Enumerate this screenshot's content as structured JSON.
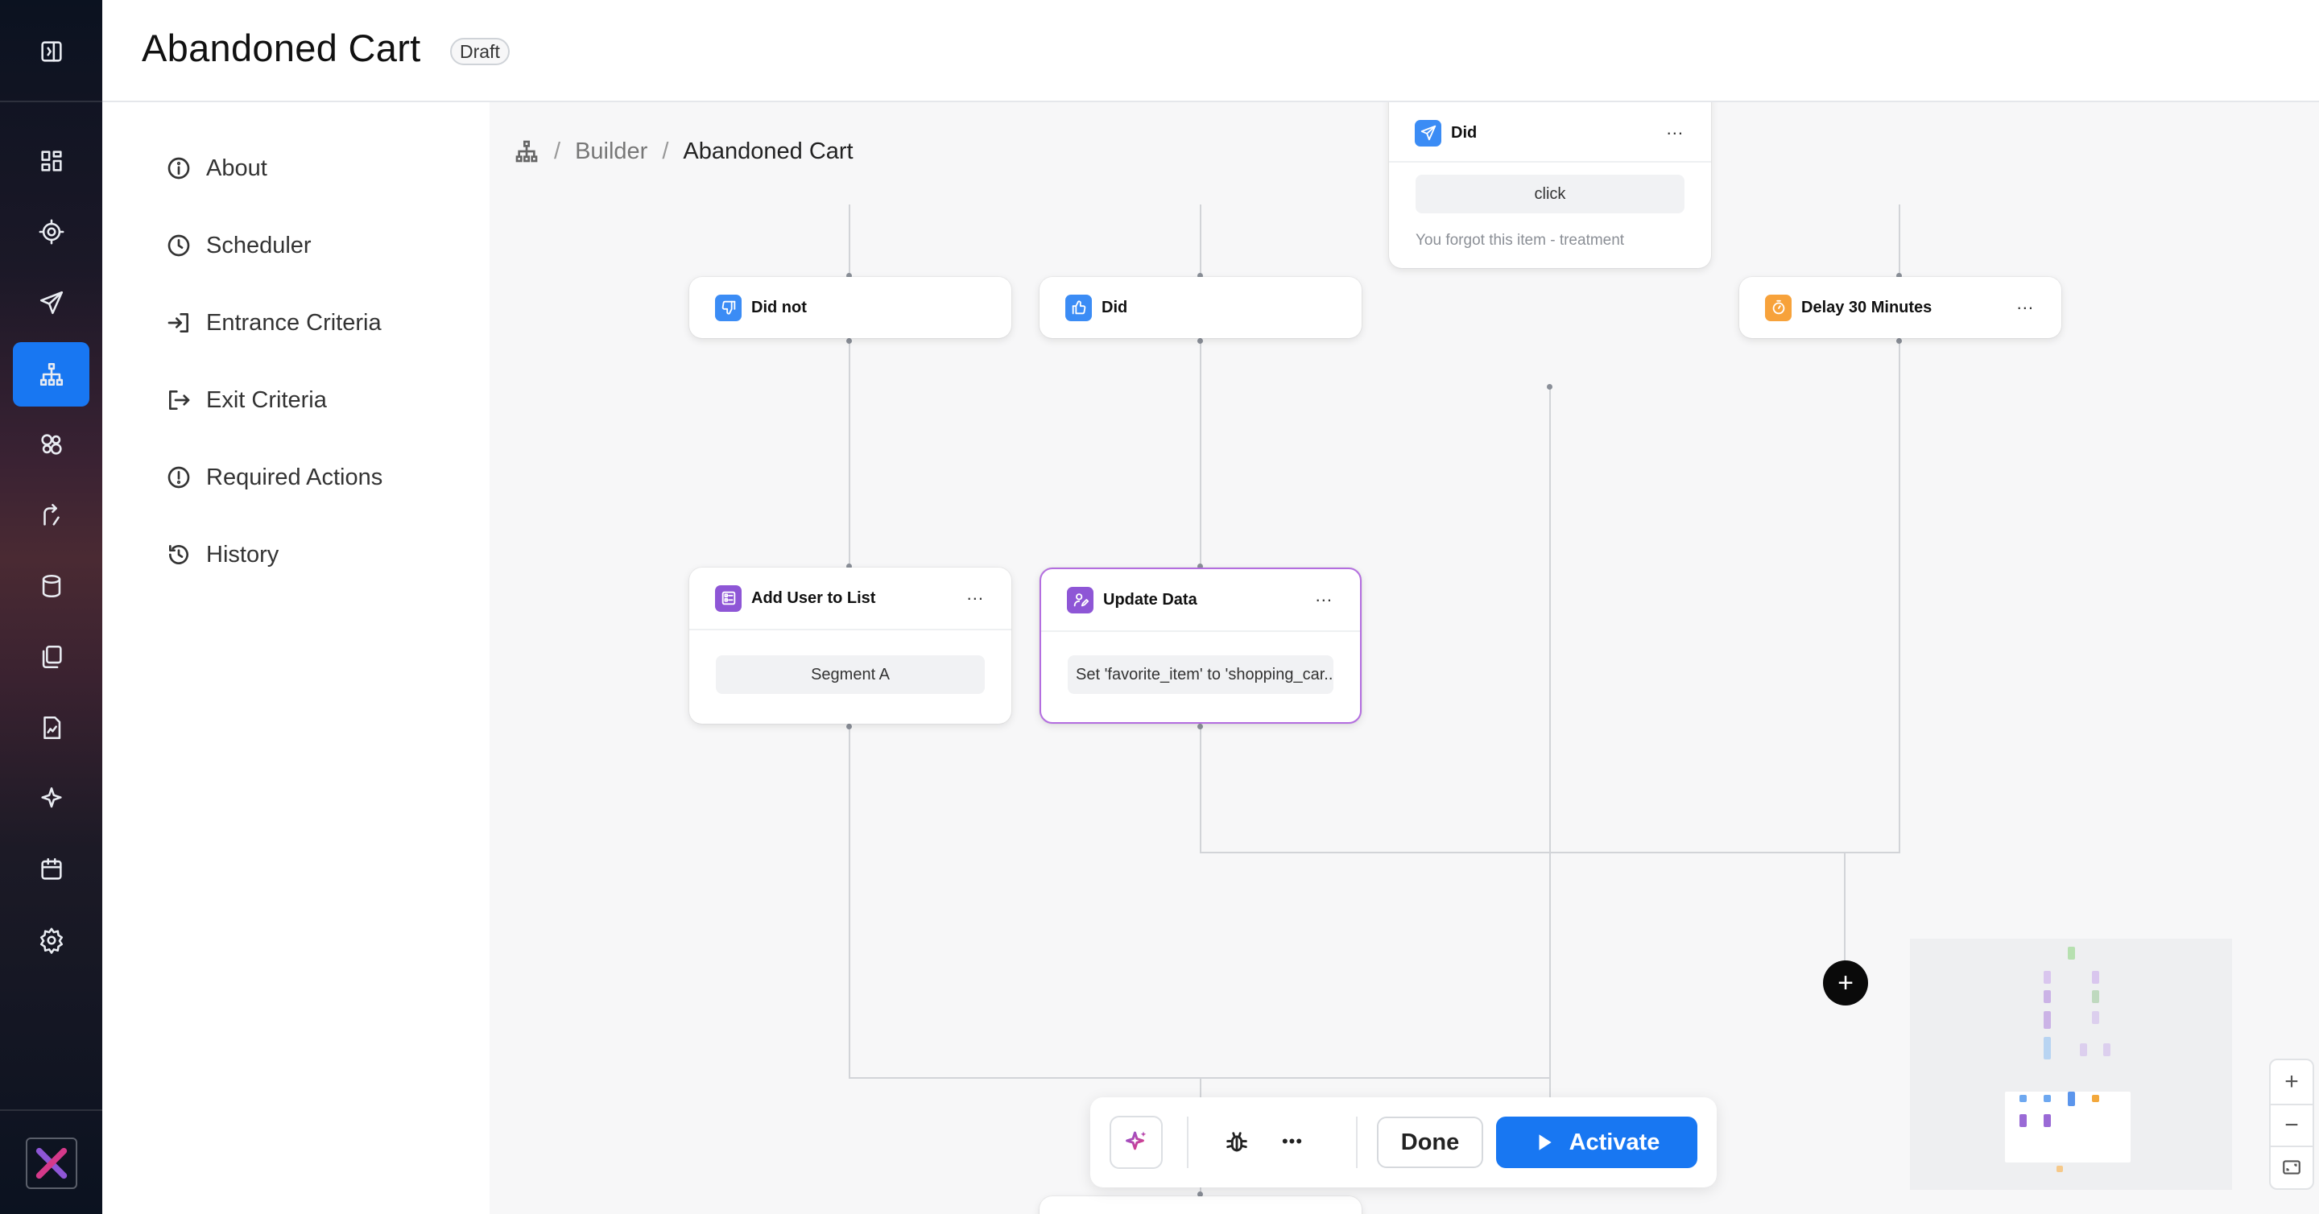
{
  "header": {
    "title": "Abandoned Cart",
    "status_badge": "Draft"
  },
  "rail": {
    "items": [
      {
        "icon": "sidebar-toggle-icon"
      },
      {
        "icon": "dashboard-icon"
      },
      {
        "icon": "target-icon"
      },
      {
        "icon": "send-icon"
      },
      {
        "icon": "flow-builder-icon",
        "active": true
      },
      {
        "icon": "segments-icon"
      },
      {
        "icon": "journey-icon"
      },
      {
        "icon": "database-icon"
      },
      {
        "icon": "templates-icon"
      },
      {
        "icon": "reports-icon"
      },
      {
        "icon": "ai-sparkle-icon"
      },
      {
        "icon": "calendar-icon"
      },
      {
        "icon": "settings-icon"
      },
      {
        "icon": "app-logo"
      }
    ]
  },
  "sidemenu": {
    "items": [
      {
        "label": "About",
        "icon": "info-icon"
      },
      {
        "label": "Scheduler",
        "icon": "clock-icon"
      },
      {
        "label": "Entrance Criteria",
        "icon": "enter-icon"
      },
      {
        "label": "Exit Criteria",
        "icon": "exit-icon"
      },
      {
        "label": "Required Actions",
        "icon": "alert-icon"
      },
      {
        "label": "History",
        "icon": "history-icon"
      }
    ]
  },
  "breadcrumb": {
    "root_icon": "flow-builder-icon",
    "parent": "Builder",
    "separator": "/",
    "current": "Abandoned Cart"
  },
  "nodes": {
    "did_send": {
      "title": "Did",
      "menu": "...",
      "chip": "click",
      "subtext": "You forgot this item - treatment",
      "icon": "send-icon",
      "color": "#3b8cf5"
    },
    "did_not": {
      "title": "Did not",
      "icon": "thumbs-down-icon",
      "color": "#3b8cf5"
    },
    "did": {
      "title": "Did",
      "icon": "thumbs-up-icon",
      "color": "#3b8cf5"
    },
    "delay": {
      "title": "Delay 30 Minutes",
      "menu": "...",
      "icon": "timer-icon",
      "color": "#f7a23b"
    },
    "add_user": {
      "title": "Add User to List",
      "menu": "...",
      "chip": "Segment A",
      "icon": "list-icon",
      "color": "#8e56d6"
    },
    "update_data": {
      "title": "Update Data",
      "menu": "...",
      "chip": "Set 'favorite_item' to 'shopping_car...",
      "icon": "user-edit-icon",
      "color": "#8e56d6"
    }
  },
  "canvas_controls": {
    "add_button": "+",
    "zoom_in": "+",
    "zoom_out": "−",
    "fit_icon": "fit-view-icon"
  },
  "toolbar": {
    "ai_icon": "ai-sparkle-icon",
    "debug_icon": "bug-icon",
    "more": "•••",
    "done": "Done",
    "activate": "Activate"
  },
  "colors": {
    "accent": "#1877f2",
    "purple": "#8e56d6",
    "orange": "#f7a23b",
    "selected_border": "#b46ee0"
  }
}
